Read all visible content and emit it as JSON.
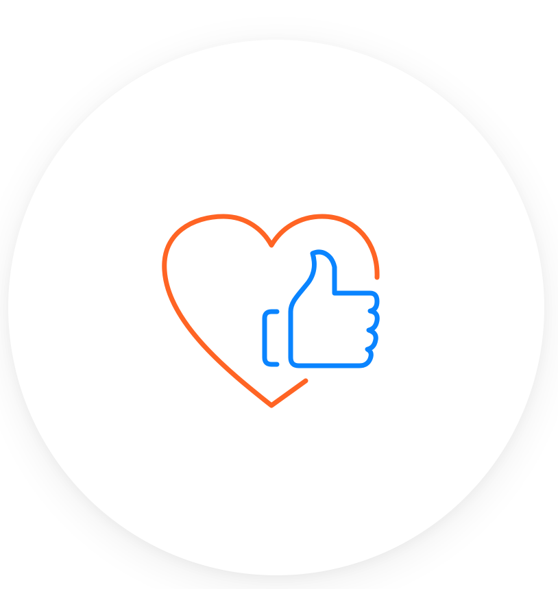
{
  "icon": {
    "name": "heart-thumbs-up-icon",
    "heart_color": "#FF6424",
    "thumb_color": "#0A84FF"
  },
  "badge": {
    "background": "#FFFFFF"
  }
}
